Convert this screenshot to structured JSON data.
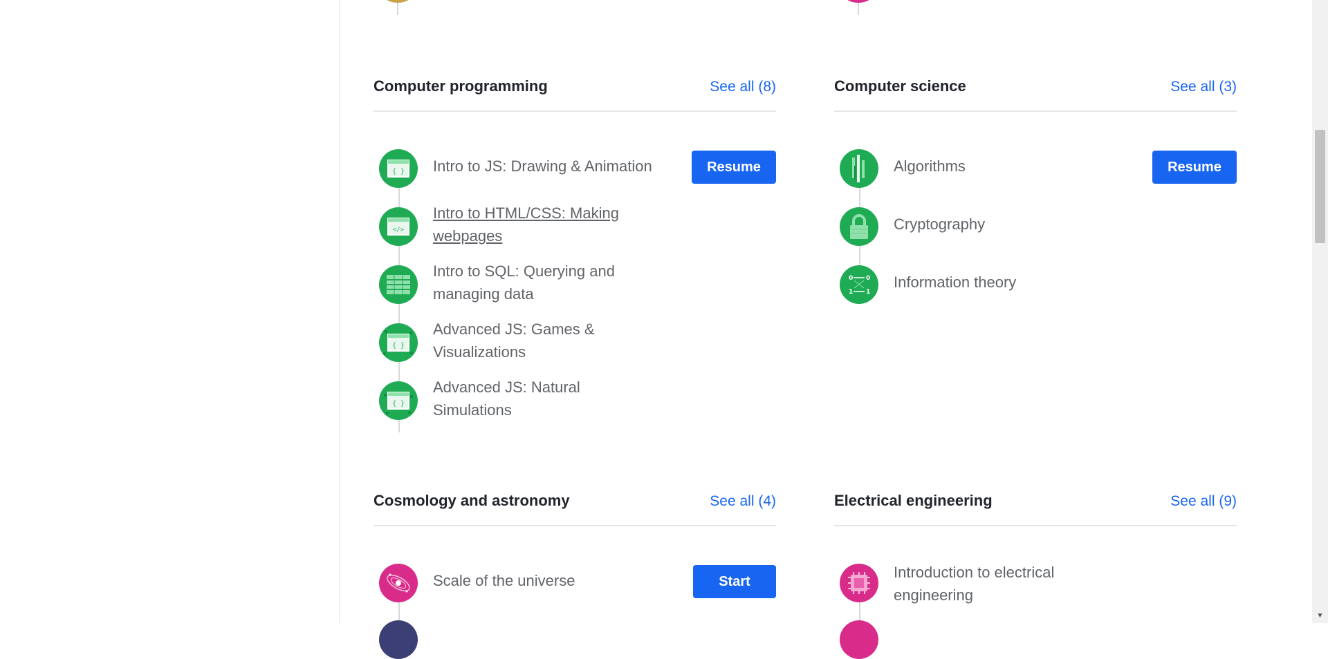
{
  "sections": [
    {
      "title": "Computer programming",
      "see_all": "See all (8)",
      "courses": [
        {
          "title": "Intro to JS: Drawing & Animation",
          "icon": "js-code-icon",
          "action": "Resume"
        },
        {
          "title": "Intro to HTML/CSS: Making webpages",
          "icon": "html-code-icon"
        },
        {
          "title": "Intro to SQL: Querying and managing data",
          "icon": "sql-table-icon"
        },
        {
          "title": "Advanced JS: Games & Visualizations",
          "icon": "js-games-icon"
        },
        {
          "title": "Advanced JS: Natural Simulations",
          "icon": "js-simulations-icon"
        }
      ]
    },
    {
      "title": "Computer science",
      "see_all": "See all (3)",
      "courses": [
        {
          "title": "Algorithms",
          "icon": "algorithms-icon",
          "action": "Resume"
        },
        {
          "title": "Cryptography",
          "icon": "lock-icon"
        },
        {
          "title": "Information theory",
          "icon": "binary-channel-icon",
          "icon_text": [
            "0",
            "0",
            "1",
            "1"
          ]
        }
      ]
    },
    {
      "title": "Cosmology and astronomy",
      "see_all": "See all (4)",
      "courses": [
        {
          "title": "Scale of the universe",
          "icon": "galaxy-icon",
          "action": "Start"
        }
      ]
    },
    {
      "title": "Electrical engineering",
      "see_all": "See all (9)",
      "courses": [
        {
          "title": "Introduction to electrical engineering",
          "icon": "microchip-icon"
        }
      ]
    }
  ],
  "colors": {
    "accent": "#1865f2",
    "programming_green": "#1fab54",
    "science_pink": "#d92c8a",
    "text_dark": "#21242c",
    "text_muted": "#606368"
  }
}
